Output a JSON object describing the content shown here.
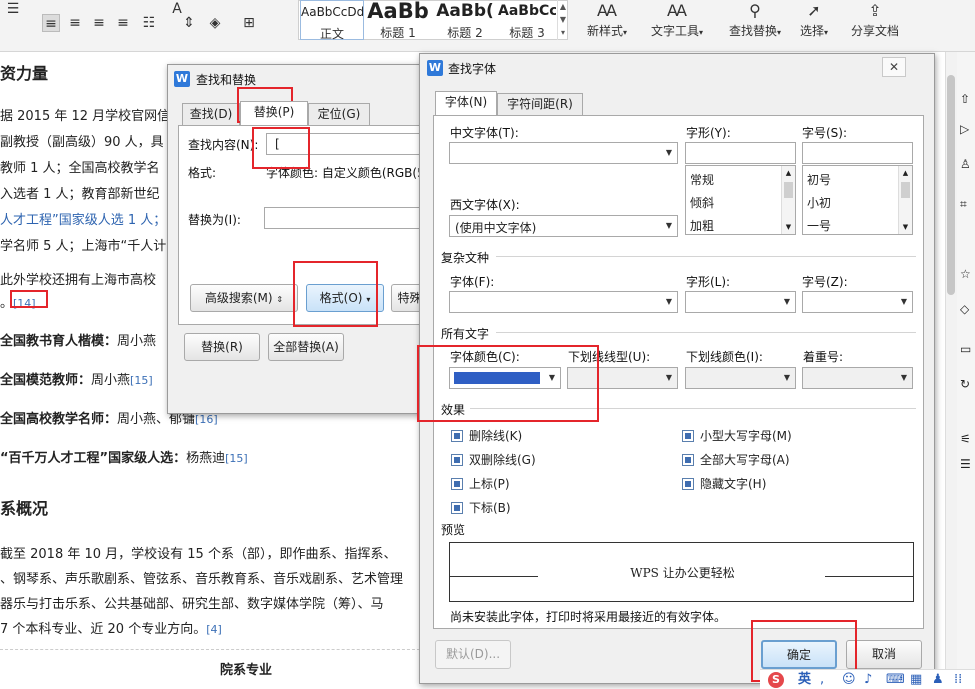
{
  "ribbon": {
    "styles": [
      {
        "sample": "AaBbCcDd",
        "name": "正文"
      },
      {
        "sample": "AaBb",
        "name": "标题 1"
      },
      {
        "sample": "AaBb(",
        "name": "标题 2"
      },
      {
        "sample": "AaBbCcI",
        "name": "标题 3"
      }
    ],
    "buttons": {
      "new_style": "新样式",
      "text_tools": "文字工具",
      "find_replace": "查找替换",
      "select": "选择",
      "share": "分享文档"
    }
  },
  "document": {
    "lines": [
      {
        "text": "资力量",
        "bold": true
      },
      {
        "text": "据 2015 年 12 月学校官网信"
      },
      {
        "text": "副教授（副高级）90 人，具"
      },
      {
        "text": "教师 1 人；全国高校教学名"
      },
      {
        "text": "入选者 1 人；教育部新世纪"
      },
      {
        "text": "人才工程”国家级人选 1 人；",
        "link_part": "人才工程"
      },
      {
        "text": "学名师 5 人；上海市“千人计"
      },
      {
        "text": "此外学校还拥有上海市高校"
      },
      {
        "text": "。",
        "ref": "[14]"
      },
      {
        "bold_part": "全国教书育人楷模：",
        "text": "周小燕"
      },
      {
        "bold_part": "全国模范教师：",
        "text": "周小燕",
        "ref": "[15]"
      },
      {
        "bold_part": "全国高校教学名师：",
        "text": "周小燕、郁镛",
        "ref": "[16]"
      },
      {
        "bold_part": "“百千万人才工程”国家级人选：",
        "text": "杨燕迪",
        "ref": "[15]"
      },
      {
        "text": "系概况",
        "bold": true
      },
      {
        "text": "截至 2018 年 10 月，学校设有 15 个系（部），即作曲系、指挥系、"
      },
      {
        "text": "、钢琴系、声乐歌剧系、管弦系、音乐教育系、音乐戏剧系、艺术管理"
      },
      {
        "text": "器乐与打击乐系、公共基础部、研究生部、数字媒体学院（筹）、马"
      },
      {
        "text": "7 个本科专业、近 20 个专业方向。",
        "ref": "[4]"
      },
      {
        "text": "院系专业",
        "bold": true
      }
    ]
  },
  "find_replace": {
    "title": "查找和替换",
    "tabs": [
      "查找(D)",
      "替换(P)",
      "定位(G)"
    ],
    "find_label": "查找内容(N):",
    "find_value": "[",
    "format_label": "格式:",
    "format_value": "字体颜色: 自定义颜色(RGB(5",
    "replace_label": "替换为(I):",
    "replace_value": "",
    "advanced_button": "高级搜索(M)",
    "format_button": "格式(O)",
    "special_button": "特殊",
    "replace_button": "替换(R)",
    "replace_all_button": "全部替换(A)"
  },
  "find_font": {
    "title": "查找字体",
    "tabs": [
      "字体(N)",
      "字符间距(R)"
    ],
    "chinese_font_label": "中文字体(T):",
    "chinese_font_value": "",
    "style_label": "字形(Y):",
    "size_label": "字号(S):",
    "style_options": [
      "常规",
      "倾斜",
      "加粗"
    ],
    "size_options": [
      "初号",
      "小初",
      "一号"
    ],
    "western_font_label": "西文字体(X):",
    "western_font_value": "(使用中文字体)",
    "complex_section": "复杂文种",
    "complex_font_label": "字体(F):",
    "complex_style_label": "字形(L):",
    "complex_size_label": "字号(Z):",
    "all_text_section": "所有文字",
    "font_color_label": "字体颜色(C):",
    "font_color_value": "#2f5fc4",
    "underline_type_label": "下划线线型(U):",
    "underline_color_label": "下划线颜色(I):",
    "emphasis_label": "着重号:",
    "effects_section": "效果",
    "effects_left": [
      "删除线(K)",
      "双删除线(G)",
      "上标(P)",
      "下标(B)"
    ],
    "effects_right": [
      "小型大写字母(M)",
      "全部大写字母(A)",
      "隐藏文字(H)"
    ],
    "preview_section": "预览",
    "preview_text": "WPS 让办公更轻松",
    "note": "尚未安装此字体，打印时将采用最接近的有效字体。",
    "default_button": "默认(D)...",
    "ok_button": "确定",
    "cancel_button": "取消"
  },
  "statusbar": {
    "ime": "英"
  }
}
